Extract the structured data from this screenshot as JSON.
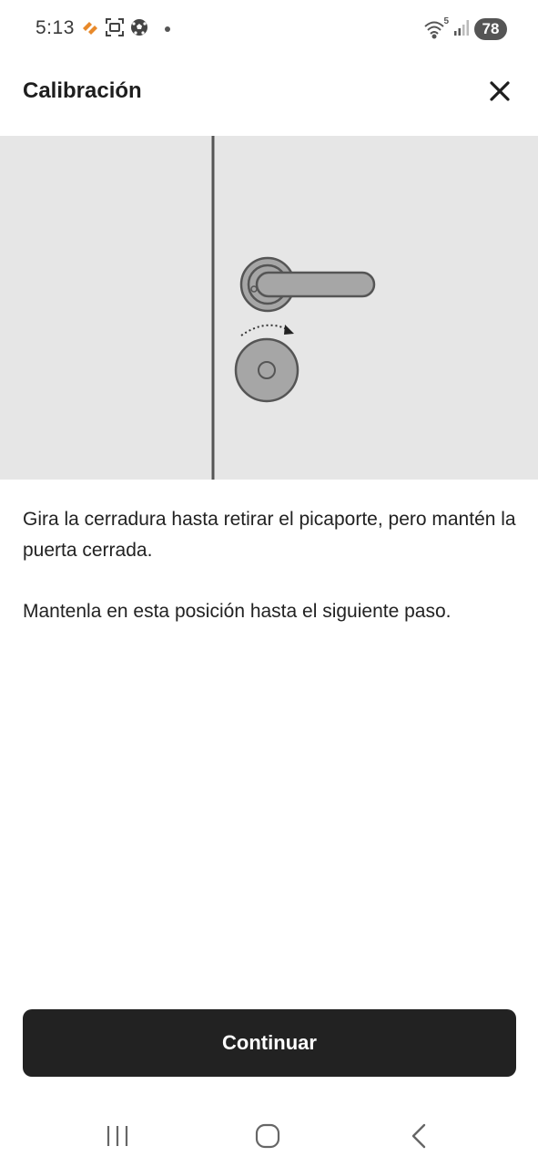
{
  "status_bar": {
    "time": "5:13",
    "left_icons": [
      "wallet-icon",
      "screenshot-icon",
      "soccer-ball-icon",
      "notification-dot"
    ],
    "right_icons": [
      "wifi-icon",
      "signal-icon"
    ],
    "network_badge": "5",
    "battery": "78"
  },
  "header": {
    "title": "Calibración",
    "close_icon": "close-icon"
  },
  "illustration": {
    "description_icon": "door-lock-illustration",
    "background_color": "#e6e6e6"
  },
  "instructions": {
    "paragraph_1": "Gira la cerradura hasta retirar el picaporte, pero mantén la puerta cerrada.",
    "paragraph_2": "Mantenla en esta posición hasta el siguiente paso."
  },
  "actions": {
    "continue_label": "Continuar",
    "button_color": "#222222"
  },
  "nav_bar": {
    "recents_icon": "recents-icon",
    "home_icon": "home-icon",
    "back_icon": "back-icon"
  }
}
